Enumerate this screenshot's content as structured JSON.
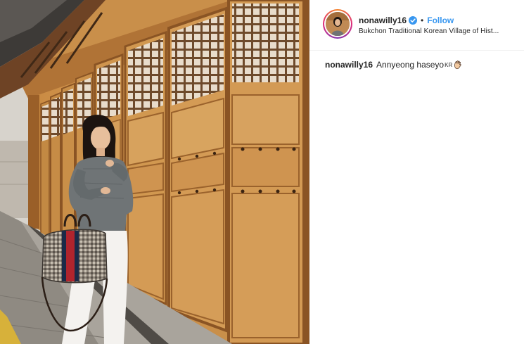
{
  "post": {
    "image_alt": "Woman in grey sweater and white jeans holding a plaid handbag in front of wooden doors of a traditional hanok",
    "header": {
      "username": "nonawilly16",
      "verified": true,
      "separator": "•",
      "follow_label": "Follow",
      "location": "Bukchon Traditional Korean Village of Hist..."
    },
    "caption": {
      "username": "nonawilly16",
      "text": "Annyeong haseyo",
      "flag_text": "KR",
      "emoji_icon": "waving-hand-icon"
    }
  },
  "colors": {
    "link_blue": "#3897f0",
    "verified_blue": "#3897f0",
    "text": "#262626",
    "divider": "#efefef"
  }
}
